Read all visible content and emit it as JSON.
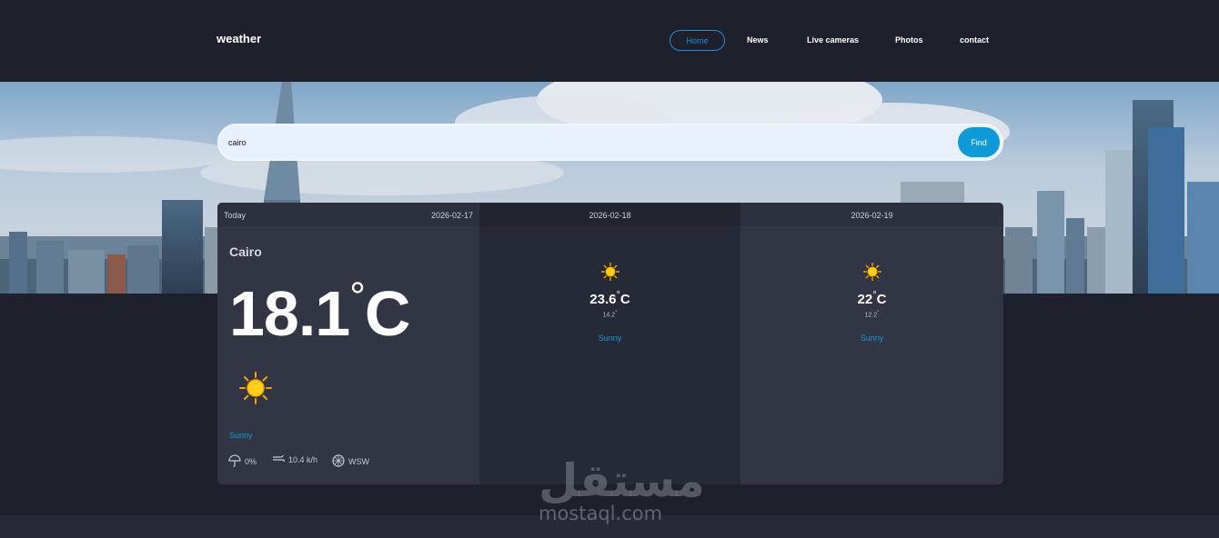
{
  "nav": {
    "brand": "weather",
    "links": [
      "Home",
      "News",
      "Live cameras",
      "Photos",
      "contact"
    ]
  },
  "search": {
    "value": "cairo",
    "button": "Find"
  },
  "today": {
    "label": "Today",
    "date": "2026-02-17",
    "city": "Cairo",
    "temp": "18.1",
    "unit": "C",
    "icon": "sun-icon",
    "condition": "Sunny",
    "rain": "0%",
    "wind": "10.4 k/h",
    "direction": "WSW"
  },
  "forecast": [
    {
      "date": "2026-02-18",
      "max": "23.6",
      "unit": "C",
      "min": "14.2",
      "condition": "Sunny",
      "icon": "sun-icon"
    },
    {
      "date": "2026-02-19",
      "max": "22",
      "unit": "C",
      "min": "12.2",
      "condition": "Sunny",
      "icon": "sun-icon"
    }
  ],
  "watermark": {
    "arabic": "مستقل",
    "latin": "mostaql.com"
  },
  "colors": {
    "accent": "#0e9ad8",
    "background": "#1e202b",
    "card": "#323543",
    "sun": "#f6b600"
  }
}
